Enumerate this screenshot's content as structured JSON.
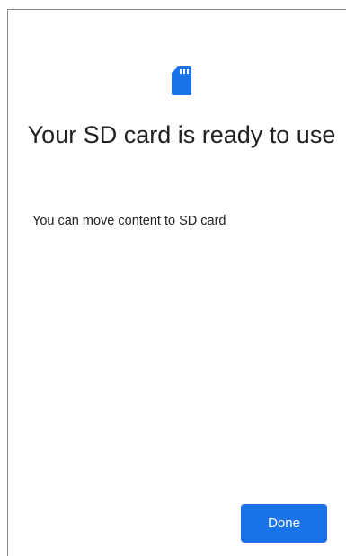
{
  "dialog": {
    "icon": "sd-card-icon",
    "title": "Your SD card is ready to use",
    "subtitle": "You can move content to SD card",
    "done_label": "Done"
  },
  "colors": {
    "accent": "#1a73e8",
    "text": "#202124"
  }
}
